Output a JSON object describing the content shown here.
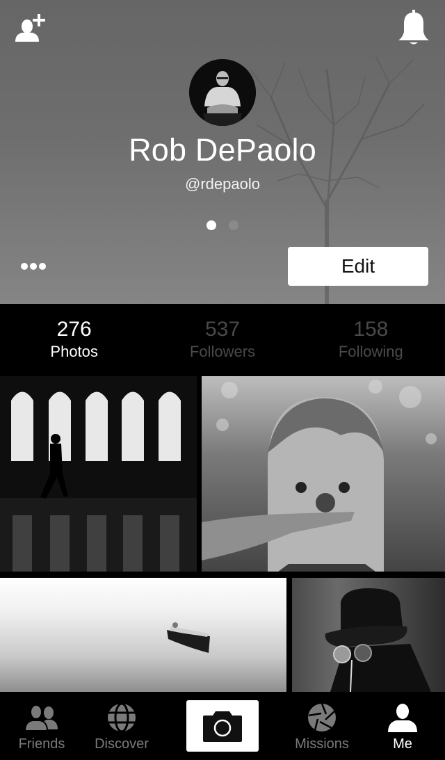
{
  "profile": {
    "name": "Rob DePaolo",
    "handle": "@rdepaolo",
    "pager": {
      "pages": 2,
      "active_index": 0
    },
    "edit_label": "Edit"
  },
  "header_icons": {
    "left": "add-friend-icon",
    "right": "bell-icon",
    "more": "more-options-icon"
  },
  "stats": [
    {
      "value": "276",
      "label": "Photos",
      "active": true
    },
    {
      "value": "537",
      "label": "Followers",
      "active": false
    },
    {
      "value": "158",
      "label": "Following",
      "active": false
    }
  ],
  "photos": [
    {
      "subject": "Silhouette walking past arched windows"
    },
    {
      "subject": "Cross-eyed boy with spiky seed pod"
    },
    {
      "subject": "Rowboat in fog"
    },
    {
      "subject": "Figure in bowler hat and plague-doctor goggles"
    }
  ],
  "tabbar": {
    "tabs": [
      {
        "label": "Friends",
        "icon": "friends-icon",
        "active": false
      },
      {
        "label": "Discover",
        "icon": "globe-icon",
        "active": false
      },
      {
        "label": "Missions",
        "icon": "aperture-icon",
        "active": false
      },
      {
        "label": "Me",
        "icon": "user-icon",
        "active": true
      }
    ],
    "camera_icon": "camera-icon"
  },
  "colors": {
    "active_text": "#ffffff",
    "inactive_stat_text": "#4a4a4a",
    "inactive_tab_text": "#7a7a7a",
    "background": "#000000"
  }
}
